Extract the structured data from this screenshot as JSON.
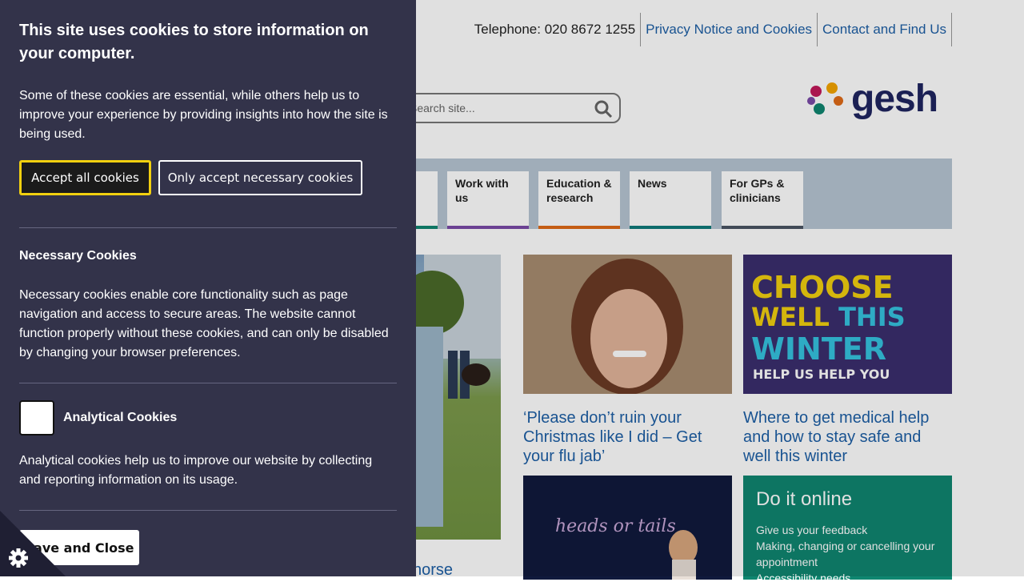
{
  "header": {
    "telephone_label": "Telephone: 020 8672 1255",
    "links": [
      "Privacy Notice and Cookies",
      "Contact and Find Us"
    ]
  },
  "search": {
    "placeholder": "Search site..."
  },
  "logo": {
    "text": "gesh"
  },
  "nav": {
    "items": [
      {
        "label": "Work with us",
        "color": "#7a4aa8"
      },
      {
        "label": "Education & research",
        "color": "#e06a17"
      },
      {
        "label": "News",
        "color": "#0f7a7a"
      },
      {
        "label": "For GPs & clinicians",
        "color": "#4a5563"
      }
    ]
  },
  "news": [
    {
      "title": "‘Please don’t ruin your Christmas like I did – Get your flu jab’"
    },
    {
      "title": "Where to get medical help and how to stay safe and well this winter"
    },
    {
      "title": "horse"
    }
  ],
  "promo": {
    "line1": "CHOOSE",
    "line2a": "WELL",
    "line2b": "THIS",
    "line3": "WINTER",
    "line4": "HELP US HELP YOU"
  },
  "online": {
    "title": "Do it online",
    "links": [
      "Give us your feedback",
      "Making, changing or cancelling your appointment",
      "Accessibility needs"
    ]
  },
  "cookie_panel": {
    "title": "This site uses cookies to store information on your computer.",
    "intro": "Some of these cookies are essential, while others help us to improve your experience by providing insights into how the site is being used.",
    "accept_label": "Accept all cookies",
    "necessary_label": "Only accept necessary cookies",
    "necessary_title": "Necessary Cookies",
    "necessary_text": "Necessary cookies enable core functionality such as page navigation and access to secure areas. The website cannot function properly without these cookies, and can only be disabled by changing your browser preferences.",
    "analytical_title": "Analytical Cookies",
    "analytical_checked": false,
    "analytical_text": "Analytical cookies help us to improve our website by collecting and reporting information on its usage.",
    "save_label": "Save and Close"
  },
  "colors": {
    "panel_bg": "#33334a",
    "accept_border": "#f2d00f",
    "link": "#1d5fa6"
  }
}
